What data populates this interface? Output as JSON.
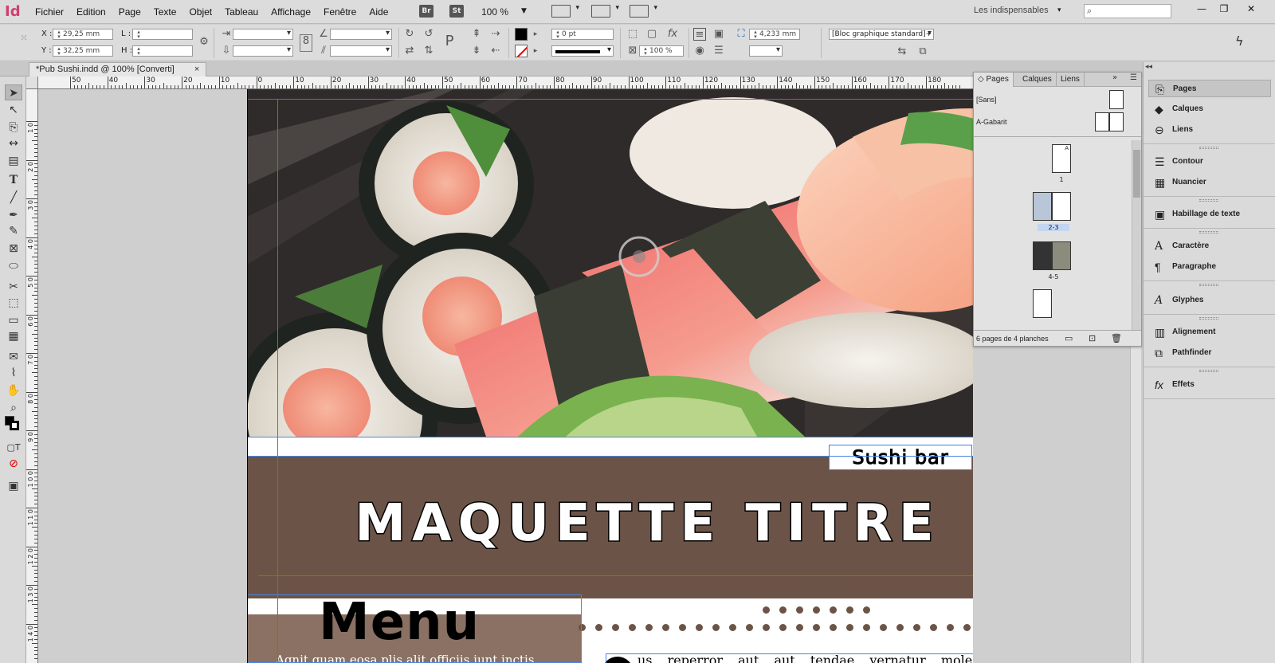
{
  "app": {
    "logo": "Id",
    "menus": [
      "Fichier",
      "Edition",
      "Page",
      "Texte",
      "Objet",
      "Tableau",
      "Affichage",
      "Fenêtre",
      "Aide"
    ],
    "bridge_badge": "Br",
    "stock_badge": "St",
    "zoom": "100 %",
    "workspace": "Les indispensables",
    "search_placeholder": ""
  },
  "control": {
    "x_label": "X :",
    "y_label": "Y :",
    "x_value": "29,25 mm",
    "y_value": "32,25 mm",
    "l_label": "L :",
    "h_label": "H :",
    "stroke_weight": "0 pt",
    "opacity": "100 %",
    "offset": "4,233 mm",
    "object_style": "[Bloc graphique standard]+"
  },
  "document": {
    "tab_title": "*Pub Sushi.indd @ 100% [Converti]",
    "close": "×"
  },
  "ruler": {
    "h_labels": [
      "50",
      "40",
      "30",
      "20",
      "10",
      "0",
      "10",
      "20",
      "30",
      "40",
      "50",
      "60",
      "70",
      "80",
      "90",
      "100",
      "110",
      "120",
      "130",
      "140",
      "150",
      "160",
      "170",
      "180"
    ],
    "v_labels": [
      "1 0",
      "2 0",
      "3 0",
      "4 0",
      "5 0",
      "6 0",
      "7 0",
      "8 0",
      "9 0",
      "1 0 0",
      "1 1 0",
      "1 2 0",
      "1 3 0",
      "1 4 0"
    ]
  },
  "layout": {
    "sushi_bar": "Sushi bar",
    "main_title": "MAQUETTE TITRE",
    "menu_heading": "Menu",
    "body_left": "Agnit quam eosa plis alit officiis iunt inctis",
    "body_right": "us reperror aut aut tendae vernatur molestioriae"
  },
  "pages_panel": {
    "tabs": [
      "Pages",
      "Calques",
      "Liens"
    ],
    "masters": [
      "[Sans]",
      "A-Gabarit"
    ],
    "page_labels": [
      "1",
      "2-3",
      "4-5"
    ],
    "master_letter": "A",
    "footer": "6 pages de 4 planches"
  },
  "dock": {
    "items": [
      "Pages",
      "Calques",
      "Liens",
      "Contour",
      "Nuancier",
      "Habillage de texte",
      "Caractère",
      "Paragraphe",
      "Glyphes",
      "Alignement",
      "Pathfinder",
      "Effets"
    ],
    "icons": [
      "pages-icon",
      "layers-icon",
      "links-icon",
      "stroke-icon",
      "swatches-icon",
      "text-wrap-icon",
      "character-icon",
      "paragraph-icon",
      "glyphs-icon",
      "align-icon",
      "pathfinder-icon",
      "effects-icon"
    ]
  },
  "colors": {
    "brand": "#d0406f",
    "brown_band": "#6b5447",
    "menu_band": "#8a7163",
    "guide": "#a142d4",
    "frame": "#4a86e0"
  }
}
